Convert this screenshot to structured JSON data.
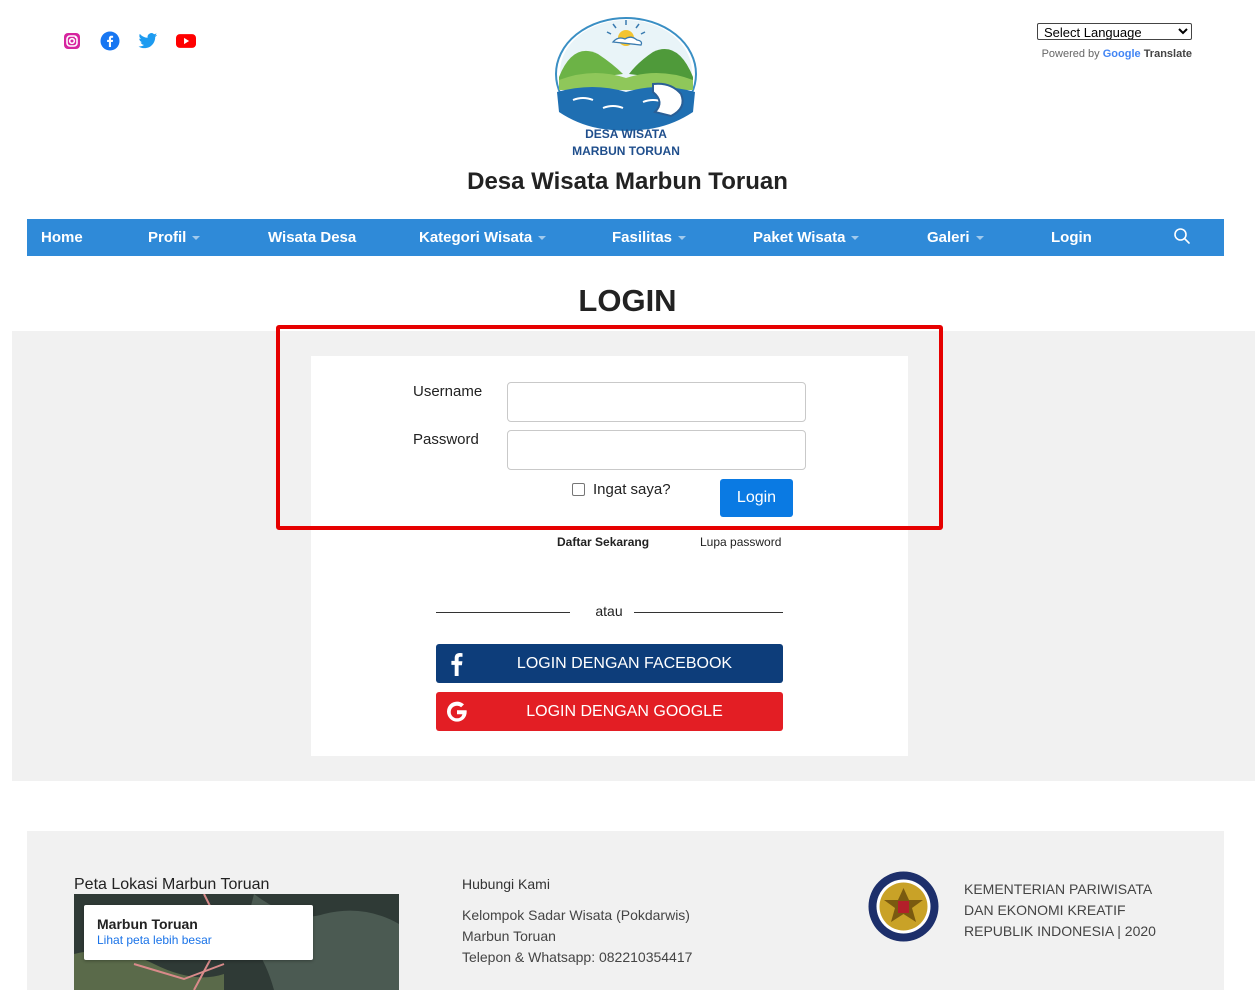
{
  "header": {
    "social_icons": [
      "instagram-icon",
      "facebook-icon",
      "twitter-icon",
      "youtube-icon"
    ],
    "language_select": "Select Language",
    "powered_by": "Powered by",
    "google": "Google",
    "translate": "Translate",
    "logo_text_line1": "DESA WISATA",
    "logo_text_line2": "MARBUN TORUAN",
    "site_title": "Desa Wisata Marbun Toruan"
  },
  "nav": {
    "items": [
      {
        "label": "Home"
      },
      {
        "label": "Profil"
      },
      {
        "label": "Wisata Desa"
      },
      {
        "label": "Kategori Wisata"
      },
      {
        "label": "Fasilitas"
      },
      {
        "label": "Paket Wisata"
      },
      {
        "label": "Galeri"
      },
      {
        "label": "Login"
      }
    ]
  },
  "login": {
    "heading": "LOGIN",
    "username_label": "Username",
    "password_label": "Password",
    "remember_label": "Ingat saya?",
    "submit_label": "Login",
    "register_link": "Daftar Sekarang",
    "forgot_link": "Lupa password",
    "separator": "atau",
    "facebook_button": "LOGIN DENGAN FACEBOOK",
    "google_button": "LOGIN DENGAN GOOGLE"
  },
  "footer": {
    "map_heading": "Peta Lokasi Marbun Toruan",
    "map_place": "Marbun Toruan",
    "map_link": "Lihat peta lebih besar",
    "contact_heading": "Hubungi Kami",
    "contact_line1": "Kelompok Sadar Wisata (Pokdarwis)",
    "contact_line2": "Marbun Toruan",
    "contact_line3": "Telepon & Whatsapp: 082210354417",
    "ministry_line1": "KEMENTERIAN PARIWISATA",
    "ministry_line2": "DAN EKONOMI KREATIF",
    "ministry_line3": "REPUBLIK INDONESIA | 2020"
  },
  "colors": {
    "nav": "#2f8ad8",
    "login_button": "#0a7ae3",
    "facebook": "#0d3d7a",
    "google": "#e31e24",
    "highlight": "#e60000"
  }
}
